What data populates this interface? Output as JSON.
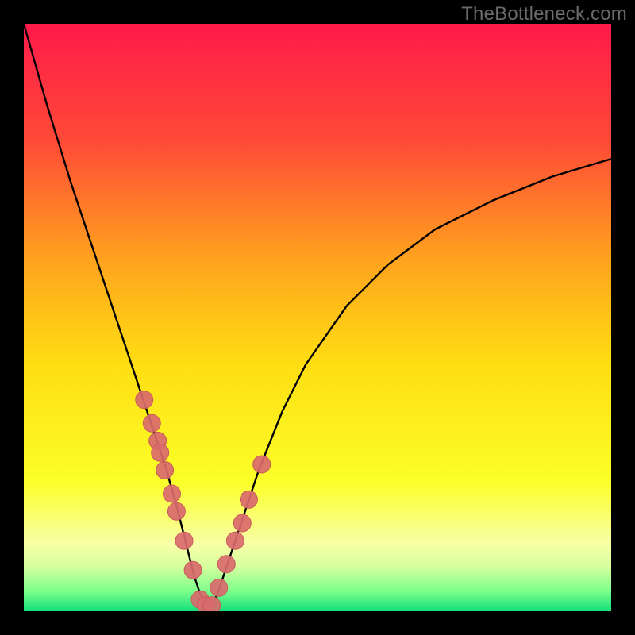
{
  "watermark": "TheBottleneck.com",
  "colors": {
    "frame": "#000000",
    "gradient_stops": [
      {
        "offset": 0.0,
        "color": "#ff1a4b"
      },
      {
        "offset": 0.2,
        "color": "#ff4a37"
      },
      {
        "offset": 0.4,
        "color": "#ffa21e"
      },
      {
        "offset": 0.58,
        "color": "#ffde12"
      },
      {
        "offset": 0.78,
        "color": "#fbff29"
      },
      {
        "offset": 0.885,
        "color": "#f8ffa6"
      },
      {
        "offset": 0.925,
        "color": "#d5ff9e"
      },
      {
        "offset": 0.965,
        "color": "#7eff8c"
      },
      {
        "offset": 1.0,
        "color": "#13e07a"
      }
    ],
    "curve": "#000000",
    "marker_fill": "#d96a6d",
    "marker_stroke": "#c95a5d"
  },
  "chart_data": {
    "type": "line",
    "title": "",
    "xlabel": "",
    "ylabel": "",
    "xlim": [
      0,
      100
    ],
    "ylim": [
      0,
      100
    ],
    "series": [
      {
        "name": "bottleneck-curve",
        "x": [
          0,
          4,
          8,
          12,
          15,
          18,
          20,
          22,
          24,
          26,
          27,
          28,
          29,
          30,
          31,
          32,
          33,
          34,
          36,
          38,
          40,
          44,
          48,
          55,
          62,
          70,
          80,
          90,
          100
        ],
        "y": [
          100,
          86,
          73,
          61,
          52,
          43,
          37,
          31,
          25,
          18,
          14,
          10,
          6,
          3,
          1,
          1,
          3,
          6,
          12,
          18,
          24,
          34,
          42,
          52,
          59,
          65,
          70,
          74,
          77
        ]
      }
    ],
    "markers": {
      "name": "highlight-points",
      "x": [
        20.5,
        21.8,
        22.8,
        23.2,
        24.0,
        25.2,
        26.0,
        27.3,
        28.8,
        30.0,
        31.0,
        32.0,
        33.2,
        34.5,
        36.0,
        37.2,
        38.3,
        40.5
      ],
      "y": [
        36,
        32,
        29,
        27,
        24,
        20,
        17,
        12,
        7,
        2,
        1,
        1,
        4,
        8,
        12,
        15,
        19,
        25
      ]
    }
  }
}
